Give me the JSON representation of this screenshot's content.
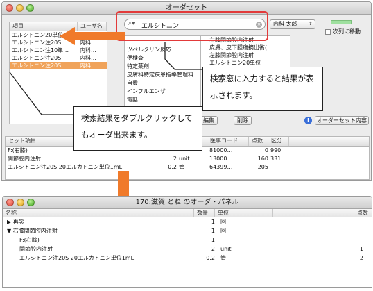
{
  "top_window": {
    "title": "オーダセット",
    "search": {
      "value": "エルシトニン"
    },
    "user_select": "内科 太郎",
    "next_checkbox": "次列に移動",
    "result_headers": [
      "項目",
      "ユーザ名"
    ],
    "results": [
      {
        "item": "エルシトニン20単位",
        "user": ""
      },
      {
        "item": "エルシトニン注20S",
        "user": "内科…"
      },
      {
        "item": "エルシトニン注10単…",
        "user": "内科…"
      },
      {
        "item": "エルシトニン注20S",
        "user": "内科…"
      },
      {
        "item": "エルシトニン注20S",
        "user": "内科"
      }
    ],
    "categories": [
      "ツベルクリン反応",
      "便検査",
      "特定薬剤",
      "皮膚科特定疾患指導管理料",
      "自費",
      "インフルエンザ",
      "電話"
    ],
    "tree_items": [
      "右膝関節腔内注射",
      "皮膚、皮下腫瘍摘出術(…",
      "左膝関節腔内注射",
      "エルシトニン20単位"
    ],
    "buttons": {
      "edit": "編集",
      "delete": "削除",
      "order_set_content": "オーダーセット内容"
    },
    "table_headers": [
      "セット項目",
      "医事コード",
      "点数",
      "区分"
    ],
    "table_rows": [
      {
        "name": "F:(右膝)",
        "qty": "",
        "unit": "",
        "code": "81000…",
        "points": "0",
        "cat": "990"
      },
      {
        "name": "関節腔内注射",
        "qty": "2",
        "unit": "unit",
        "code": "13000…",
        "points": "160",
        "cat": "331"
      },
      {
        "name": "エルシトニン注20S 20エルカトニン単位1mL",
        "qty": "0.2",
        "unit": "管",
        "code": "64399…",
        "points": "205",
        "cat": ""
      }
    ]
  },
  "callouts": {
    "search_hint": "検索窓に入力すると結果が表示されます。",
    "double_click_hint": "検索結果をダブルクリックしてもオーダ出来ます。"
  },
  "bottom_window": {
    "title": "170:滋賀  とね のオーダ・パネル",
    "headers": [
      "名称",
      "数量",
      "単位",
      "点数"
    ],
    "rows": [
      {
        "name": "▶ 再診",
        "qty": "1",
        "unit": "回",
        "points": "",
        "indent": 0
      },
      {
        "name": "▼ 右膝関節腔内注射",
        "qty": "1",
        "unit": "回",
        "points": "",
        "indent": 0
      },
      {
        "name": "F:(右膝)",
        "qty": "1",
        "unit": "",
        "points": "",
        "indent": 1
      },
      {
        "name": "関節腔内注射",
        "qty": "2",
        "unit": "unit",
        "points": "1",
        "indent": 1
      },
      {
        "name": "エルシトニン注20S 20エルカトニン単位1mL",
        "qty": "0.2",
        "unit": "管",
        "points": "2",
        "indent": 1
      }
    ]
  },
  "colors": {
    "arrow": "#f07a2a",
    "highlight": "#e23a3a",
    "selection": "#f0a35a"
  }
}
